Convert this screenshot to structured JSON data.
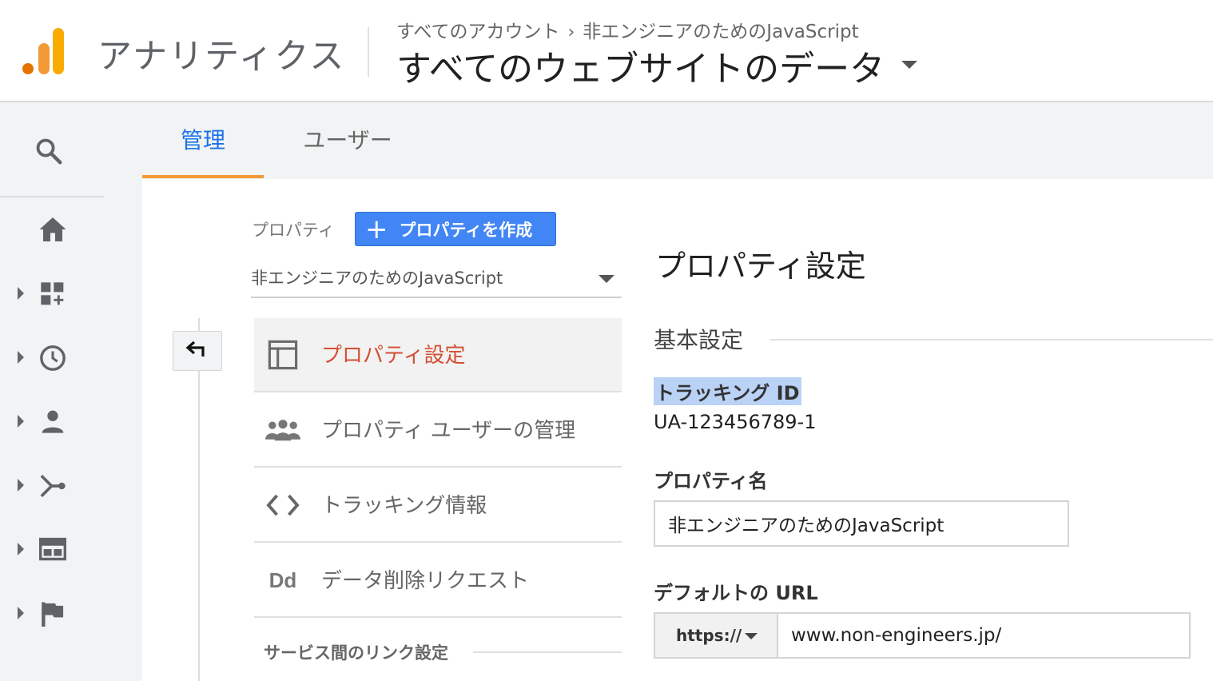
{
  "header": {
    "app_name": "アナリティクス",
    "breadcrumb": {
      "root": "すべてのアカウント",
      "separator": "›",
      "current": "非エンジニアのためのJavaScript"
    },
    "view_title": "すべてのウェブサイトのデータ"
  },
  "logo": {
    "icon": "analytics-logo-icon",
    "colors": [
      "#e37400",
      "#f9ab00",
      "#f29a36"
    ]
  },
  "left_rail": {
    "items": [
      {
        "icon": "search-icon"
      },
      {
        "icon": "home-icon"
      },
      {
        "icon": "customization-icon"
      },
      {
        "icon": "realtime-clock-icon"
      },
      {
        "icon": "audience-person-icon"
      },
      {
        "icon": "acquisition-icon"
      },
      {
        "icon": "behavior-icon"
      },
      {
        "icon": "conversions-flag-icon"
      }
    ]
  },
  "tabs": [
    {
      "label": "管理",
      "active": true
    },
    {
      "label": "ユーザー",
      "active": false
    }
  ],
  "property_column": {
    "label": "プロパティ",
    "create_button": {
      "plus": "+",
      "label": "プロパティを作成"
    },
    "selected_property": "非エンジニアのためのJavaScript",
    "menu": [
      {
        "label": "プロパティ設定",
        "icon": "property-settings-icon",
        "active": true
      },
      {
        "label": "プロパティ ユーザーの管理",
        "icon": "users-group-icon",
        "active": false
      },
      {
        "label": "トラッキング情報",
        "icon": "code-brackets-icon",
        "active": false
      },
      {
        "label": "データ削除リクエスト",
        "icon": "data-deletion-icon",
        "icon_text": "Dd",
        "active": false
      }
    ],
    "section_heading": "サービス間のリンク設定"
  },
  "settings": {
    "page_title": "プロパティ設定",
    "basic_heading": "基本設定",
    "tracking_id_label": "トラッキング ID",
    "tracking_id": "UA-123456789-1",
    "property_name_label": "プロパティ名",
    "property_name": "非エンジニアのためのJavaScript",
    "default_url_label": "デフォルトの URL",
    "protocol": "https://",
    "default_url": "www.non-engineers.jp/"
  },
  "colors": {
    "accent_blue": "#1a73e8",
    "tab_underline": "#f29a36",
    "active_menu_text": "#d34f32",
    "button_blue": "#4285f4",
    "highlight": "#bad2f5"
  }
}
